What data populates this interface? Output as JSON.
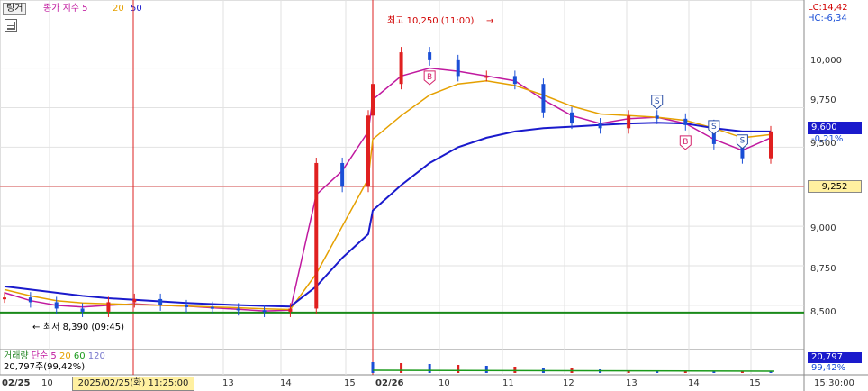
{
  "toolbar": {
    "link_button": "링거",
    "price_label": "종가 지수",
    "ma": [
      "5",
      "20",
      "50"
    ],
    "ma_colors": [
      "#c0199f",
      "#e5a000",
      "#1a1acc"
    ]
  },
  "price_panel": {
    "lc_label": "LC:14,42",
    "hc_label": "HC:-6,34",
    "high_annotation": "최고 10,250 (11:00)",
    "low_annotation": "최저 8,390 (09:45)",
    "last_price": "9,600",
    "last_change": "-0,21%",
    "crosshair_price": "9,252",
    "y_ticks": [
      "10,000",
      "9,750",
      "9,500",
      "9,250",
      "9,000",
      "8,750",
      "8,500"
    ],
    "markers": [
      {
        "type": "B",
        "color": "#d4236b"
      },
      {
        "type": "B",
        "color": "#d4236b"
      },
      {
        "type": "S",
        "color": "#2a4ea6"
      },
      {
        "type": "S",
        "color": "#2a4ea6"
      },
      {
        "type": "S",
        "color": "#2a4ea6"
      }
    ]
  },
  "volume_panel": {
    "label": "거래량",
    "ma_label": "단순",
    "ma": [
      "5",
      "20",
      "60",
      "120"
    ],
    "ma_colors": [
      "#c0199f",
      "#e5a000",
      "#1a9a1a",
      "#7777cc"
    ],
    "volume_info": "20,797주(99,42%)",
    "last_volume": "20,797",
    "last_volume_pct": "99,42%"
  },
  "x_axis": {
    "labels": [
      "02/25",
      "10",
      "13",
      "14",
      "15",
      "02/26",
      "10",
      "11",
      "12",
      "13",
      "14",
      "15",
      "15:30:00"
    ],
    "crosshair_time": "2025/02/25(화) 11:25:00"
  },
  "chart_data": {
    "type": "line",
    "title": "",
    "ylabel": "",
    "xlabel": "",
    "ylim": [
      8300,
      10400
    ],
    "grid": true,
    "days": [
      "02/25",
      "02/26"
    ],
    "series": [
      {
        "name": "종가",
        "values": [
          8550,
          8520,
          8480,
          8460,
          8520,
          8540,
          8500,
          8490,
          8480,
          8470,
          8460,
          8480,
          9400,
          9250,
          9700,
          9900,
          10100,
          10050,
          9950,
          9950,
          9900,
          9720,
          9650,
          9620,
          9700,
          9680,
          9640,
          9520,
          9430,
          9600
        ]
      },
      {
        "name": "5",
        "values": [
          8580,
          8530,
          8500,
          8490,
          8500,
          8510,
          8500,
          8495,
          8485,
          8475,
          8465,
          8470,
          9200,
          9350,
          9600,
          9800,
          9950,
          10000,
          9980,
          9950,
          9920,
          9800,
          9700,
          9650,
          9680,
          9690,
          9650,
          9550,
          9480,
          9560
        ]
      },
      {
        "name": "20",
        "values": [
          8600,
          8560,
          8530,
          8515,
          8510,
          8505,
          8500,
          8495,
          8490,
          8485,
          8478,
          8474,
          8700,
          9000,
          9300,
          9550,
          9700,
          9830,
          9900,
          9920,
          9890,
          9830,
          9760,
          9710,
          9700,
          9690,
          9670,
          9620,
          9560,
          9580
        ]
      },
      {
        "name": "50",
        "values": [
          8620,
          8600,
          8580,
          8560,
          8545,
          8535,
          8525,
          8515,
          8508,
          8502,
          8497,
          8493,
          8620,
          8800,
          8950,
          9100,
          9260,
          9400,
          9500,
          9560,
          9600,
          9620,
          9630,
          9640,
          9650,
          9655,
          9650,
          9620,
          9600,
          9600
        ]
      }
    ],
    "high": {
      "value": 10250,
      "time": "11:00"
    },
    "low": {
      "value": 8390,
      "time": "09:45"
    },
    "crosshair_value": 9252,
    "baseline": 8455
  }
}
